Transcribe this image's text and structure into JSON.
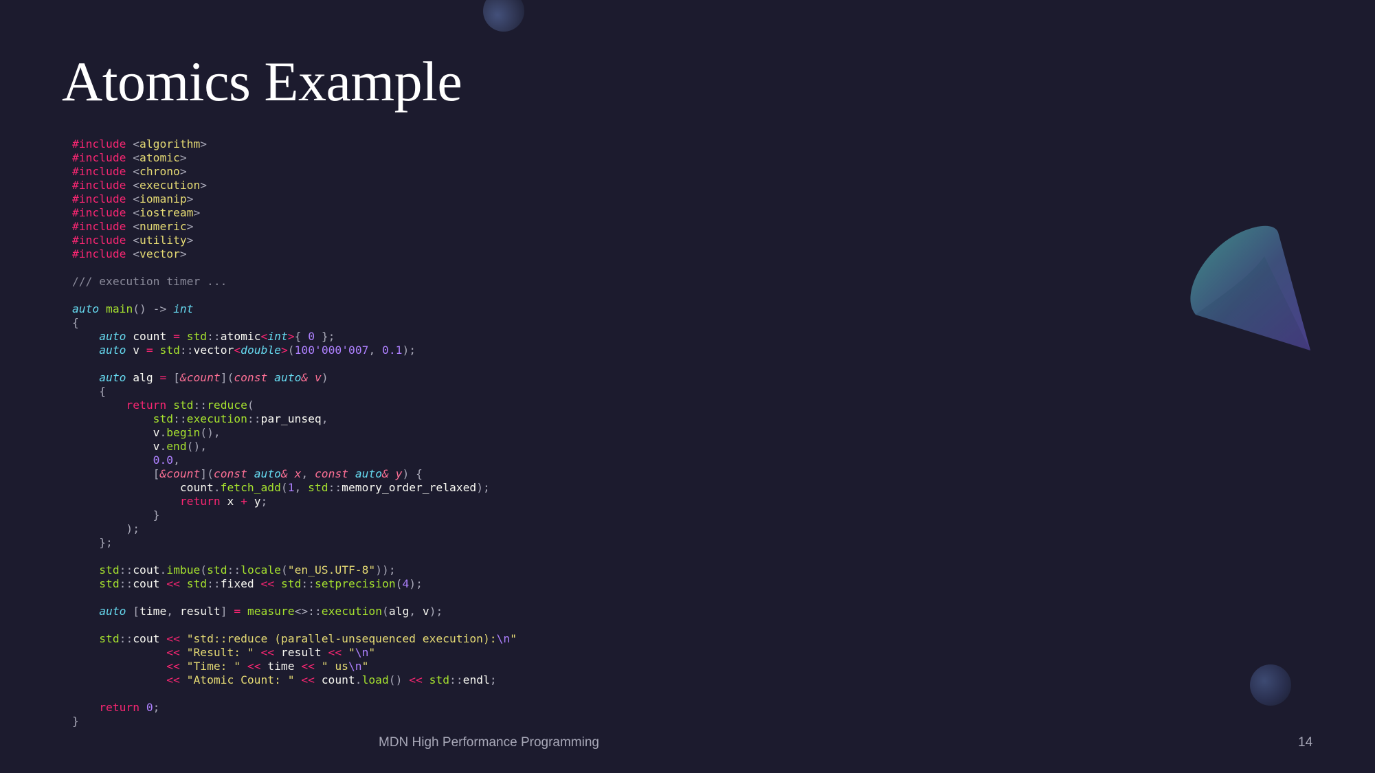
{
  "slide": {
    "title": "Atomics Example",
    "footer": "MDN High Performance Programming",
    "page_number": "14"
  },
  "code": {
    "language": "cpp",
    "lines": [
      [
        [
          "pre",
          "#include "
        ],
        [
          "punc",
          "<"
        ],
        [
          "inc",
          "algorithm"
        ],
        [
          "punc",
          ">"
        ]
      ],
      [
        [
          "pre",
          "#include "
        ],
        [
          "punc",
          "<"
        ],
        [
          "inc",
          "atomic"
        ],
        [
          "punc",
          ">"
        ]
      ],
      [
        [
          "pre",
          "#include "
        ],
        [
          "punc",
          "<"
        ],
        [
          "inc",
          "chrono"
        ],
        [
          "punc",
          ">"
        ]
      ],
      [
        [
          "pre",
          "#include "
        ],
        [
          "punc",
          "<"
        ],
        [
          "inc",
          "execution"
        ],
        [
          "punc",
          ">"
        ]
      ],
      [
        [
          "pre",
          "#include "
        ],
        [
          "punc",
          "<"
        ],
        [
          "inc",
          "iomanip"
        ],
        [
          "punc",
          ">"
        ]
      ],
      [
        [
          "pre",
          "#include "
        ],
        [
          "punc",
          "<"
        ],
        [
          "inc",
          "iostream"
        ],
        [
          "punc",
          ">"
        ]
      ],
      [
        [
          "pre",
          "#include "
        ],
        [
          "punc",
          "<"
        ],
        [
          "inc",
          "numeric"
        ],
        [
          "punc",
          ">"
        ]
      ],
      [
        [
          "pre",
          "#include "
        ],
        [
          "punc",
          "<"
        ],
        [
          "inc",
          "utility"
        ],
        [
          "punc",
          ">"
        ]
      ],
      [
        [
          "pre",
          "#include "
        ],
        [
          "punc",
          "<"
        ],
        [
          "inc",
          "vector"
        ],
        [
          "punc",
          ">"
        ]
      ],
      [],
      [
        [
          "cmt",
          "/// execution timer ..."
        ]
      ],
      [],
      [
        [
          "kw",
          "auto"
        ],
        [
          "id",
          " "
        ],
        [
          "fn",
          "main"
        ],
        [
          "punc",
          "() -> "
        ],
        [
          "kw",
          "int"
        ]
      ],
      [
        [
          "punc",
          "{"
        ]
      ],
      [
        [
          "id",
          "    "
        ],
        [
          "kw",
          "auto"
        ],
        [
          "id",
          " count "
        ],
        [
          "op",
          "="
        ],
        [
          "id",
          " "
        ],
        [
          "ns",
          "std"
        ],
        [
          "punc",
          "::"
        ],
        [
          "id",
          "atomic"
        ],
        [
          "op",
          "<"
        ],
        [
          "kw",
          "int"
        ],
        [
          "op",
          ">"
        ],
        [
          "punc",
          "{ "
        ],
        [
          "num",
          "0"
        ],
        [
          "punc",
          " };"
        ]
      ],
      [
        [
          "id",
          "    "
        ],
        [
          "kw",
          "auto"
        ],
        [
          "id",
          " v "
        ],
        [
          "op",
          "="
        ],
        [
          "id",
          " "
        ],
        [
          "ns",
          "std"
        ],
        [
          "punc",
          "::"
        ],
        [
          "id",
          "vector"
        ],
        [
          "op",
          "<"
        ],
        [
          "kw",
          "double"
        ],
        [
          "op",
          ">"
        ],
        [
          "punc",
          "("
        ],
        [
          "num",
          "100'000'007"
        ],
        [
          "punc",
          ", "
        ],
        [
          "num",
          "0.1"
        ],
        [
          "punc",
          ");"
        ]
      ],
      [],
      [
        [
          "id",
          "    "
        ],
        [
          "kw",
          "auto"
        ],
        [
          "id",
          " alg "
        ],
        [
          "op",
          "="
        ],
        [
          "id",
          " "
        ],
        [
          "punc",
          "["
        ],
        [
          "cap",
          "&count"
        ],
        [
          "punc",
          "]("
        ],
        [
          "cap",
          "const"
        ],
        [
          "id",
          " "
        ],
        [
          "kw",
          "auto"
        ],
        [
          "cap",
          "&"
        ],
        [
          "id",
          " "
        ],
        [
          "cap",
          "v"
        ],
        [
          "punc",
          ")"
        ]
      ],
      [
        [
          "punc",
          "    {"
        ]
      ],
      [
        [
          "id",
          "        "
        ],
        [
          "ret",
          "return"
        ],
        [
          "id",
          " "
        ],
        [
          "ns",
          "std"
        ],
        [
          "punc",
          "::"
        ],
        [
          "fn",
          "reduce"
        ],
        [
          "punc",
          "("
        ]
      ],
      [
        [
          "id",
          "            "
        ],
        [
          "ns",
          "std"
        ],
        [
          "punc",
          "::"
        ],
        [
          "ns",
          "execution"
        ],
        [
          "punc",
          "::"
        ],
        [
          "id",
          "par_unseq"
        ],
        [
          "punc",
          ","
        ]
      ],
      [
        [
          "id",
          "            v"
        ],
        [
          "punc",
          "."
        ],
        [
          "fn",
          "begin"
        ],
        [
          "punc",
          "(),"
        ]
      ],
      [
        [
          "id",
          "            v"
        ],
        [
          "punc",
          "."
        ],
        [
          "fn",
          "end"
        ],
        [
          "punc",
          "(),"
        ]
      ],
      [
        [
          "id",
          "            "
        ],
        [
          "num",
          "0.0"
        ],
        [
          "punc",
          ","
        ]
      ],
      [
        [
          "id",
          "            "
        ],
        [
          "punc",
          "["
        ],
        [
          "cap",
          "&count"
        ],
        [
          "punc",
          "]("
        ],
        [
          "cap",
          "const"
        ],
        [
          "id",
          " "
        ],
        [
          "kw",
          "auto"
        ],
        [
          "cap",
          "&"
        ],
        [
          "id",
          " "
        ],
        [
          "cap",
          "x"
        ],
        [
          "punc",
          ", "
        ],
        [
          "cap",
          "const"
        ],
        [
          "id",
          " "
        ],
        [
          "kw",
          "auto"
        ],
        [
          "cap",
          "&"
        ],
        [
          "id",
          " "
        ],
        [
          "cap",
          "y"
        ],
        [
          "punc",
          ") {"
        ]
      ],
      [
        [
          "id",
          "                count"
        ],
        [
          "punc",
          "."
        ],
        [
          "fn",
          "fetch_add"
        ],
        [
          "punc",
          "("
        ],
        [
          "num",
          "1"
        ],
        [
          "punc",
          ", "
        ],
        [
          "ns",
          "std"
        ],
        [
          "punc",
          "::"
        ],
        [
          "id",
          "memory_order_relaxed"
        ],
        [
          "punc",
          ");"
        ]
      ],
      [
        [
          "id",
          "                "
        ],
        [
          "ret",
          "return"
        ],
        [
          "id",
          " x "
        ],
        [
          "op",
          "+"
        ],
        [
          "id",
          " y"
        ],
        [
          "punc",
          ";"
        ]
      ],
      [
        [
          "punc",
          "            }"
        ]
      ],
      [
        [
          "punc",
          "        );"
        ]
      ],
      [
        [
          "punc",
          "    };"
        ]
      ],
      [],
      [
        [
          "id",
          "    "
        ],
        [
          "ns",
          "std"
        ],
        [
          "punc",
          "::"
        ],
        [
          "id",
          "cout"
        ],
        [
          "punc",
          "."
        ],
        [
          "fn",
          "imbue"
        ],
        [
          "punc",
          "("
        ],
        [
          "ns",
          "std"
        ],
        [
          "punc",
          "::"
        ],
        [
          "fn",
          "locale"
        ],
        [
          "punc",
          "("
        ],
        [
          "str",
          "\"en_US.UTF-8\""
        ],
        [
          "punc",
          "));"
        ]
      ],
      [
        [
          "id",
          "    "
        ],
        [
          "ns",
          "std"
        ],
        [
          "punc",
          "::"
        ],
        [
          "id",
          "cout "
        ],
        [
          "op",
          "<<"
        ],
        [
          "id",
          " "
        ],
        [
          "ns",
          "std"
        ],
        [
          "punc",
          "::"
        ],
        [
          "id",
          "fixed "
        ],
        [
          "op",
          "<<"
        ],
        [
          "id",
          " "
        ],
        [
          "ns",
          "std"
        ],
        [
          "punc",
          "::"
        ],
        [
          "fn",
          "setprecision"
        ],
        [
          "punc",
          "("
        ],
        [
          "num",
          "4"
        ],
        [
          "punc",
          ");"
        ]
      ],
      [],
      [
        [
          "id",
          "    "
        ],
        [
          "kw",
          "auto"
        ],
        [
          "id",
          " "
        ],
        [
          "punc",
          "["
        ],
        [
          "id",
          "time"
        ],
        [
          "punc",
          ", "
        ],
        [
          "id",
          "result"
        ],
        [
          "punc",
          "] "
        ],
        [
          "op",
          "="
        ],
        [
          "id",
          " "
        ],
        [
          "fn",
          "measure"
        ],
        [
          "punc",
          "<>::"
        ],
        [
          "fn",
          "execution"
        ],
        [
          "punc",
          "("
        ],
        [
          "id",
          "alg"
        ],
        [
          "punc",
          ", "
        ],
        [
          "id",
          "v"
        ],
        [
          "punc",
          ");"
        ]
      ],
      [],
      [
        [
          "id",
          "    "
        ],
        [
          "ns",
          "std"
        ],
        [
          "punc",
          "::"
        ],
        [
          "id",
          "cout "
        ],
        [
          "op",
          "<<"
        ],
        [
          "id",
          " "
        ],
        [
          "str",
          "\"std::reduce (parallel-unsequenced execution):"
        ],
        [
          "esc",
          "\\n"
        ],
        [
          "str",
          "\""
        ]
      ],
      [
        [
          "id",
          "              "
        ],
        [
          "op",
          "<<"
        ],
        [
          "id",
          " "
        ],
        [
          "str",
          "\"Result: \""
        ],
        [
          "id",
          " "
        ],
        [
          "op",
          "<<"
        ],
        [
          "id",
          " result "
        ],
        [
          "op",
          "<<"
        ],
        [
          "id",
          " "
        ],
        [
          "str",
          "\""
        ],
        [
          "esc",
          "\\n"
        ],
        [
          "str",
          "\""
        ]
      ],
      [
        [
          "id",
          "              "
        ],
        [
          "op",
          "<<"
        ],
        [
          "id",
          " "
        ],
        [
          "str",
          "\"Time: \""
        ],
        [
          "id",
          " "
        ],
        [
          "op",
          "<<"
        ],
        [
          "id",
          " time "
        ],
        [
          "op",
          "<<"
        ],
        [
          "id",
          " "
        ],
        [
          "str",
          "\" us"
        ],
        [
          "esc",
          "\\n"
        ],
        [
          "str",
          "\""
        ]
      ],
      [
        [
          "id",
          "              "
        ],
        [
          "op",
          "<<"
        ],
        [
          "id",
          " "
        ],
        [
          "str",
          "\"Atomic Count: \""
        ],
        [
          "id",
          " "
        ],
        [
          "op",
          "<<"
        ],
        [
          "id",
          " count"
        ],
        [
          "punc",
          "."
        ],
        [
          "fn",
          "load"
        ],
        [
          "punc",
          "() "
        ],
        [
          "op",
          "<<"
        ],
        [
          "id",
          " "
        ],
        [
          "ns",
          "std"
        ],
        [
          "punc",
          "::"
        ],
        [
          "id",
          "endl"
        ],
        [
          "punc",
          ";"
        ]
      ],
      [],
      [
        [
          "id",
          "    "
        ],
        [
          "ret",
          "return"
        ],
        [
          "id",
          " "
        ],
        [
          "num",
          "0"
        ],
        [
          "punc",
          ";"
        ]
      ],
      [
        [
          "punc",
          "}"
        ]
      ]
    ]
  },
  "decorations": [
    {
      "name": "orb-top-icon"
    },
    {
      "name": "cone-icon"
    },
    {
      "name": "orb-bottom-right-icon"
    }
  ]
}
